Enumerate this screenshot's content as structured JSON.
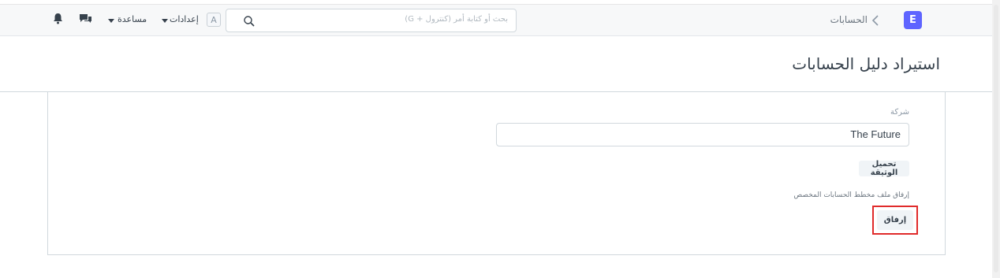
{
  "brand": {
    "letter": "E",
    "color": "#5e64ff"
  },
  "breadcrumb": {
    "label": "الحسابات"
  },
  "search": {
    "placeholder": "بحث أو كتابة أمر (كنترول + G)"
  },
  "user": {
    "avatar_letter": "A"
  },
  "nav": {
    "settings_label": "إعدادات",
    "help_label": "مساعدة"
  },
  "icons": {
    "search": "search-icon",
    "chat": "chat-icon",
    "bell": "bell-icon",
    "chevron": "chevron-icon",
    "caret": "caret-down-icon"
  },
  "page": {
    "title": "استيراد دليل الحسابات"
  },
  "form": {
    "company_label": "شركة",
    "company_value": "The Future",
    "download_template_label": "تحميل الوثيقة",
    "attach_label": "إرفاق ملف مخطط الحسابات المخصص",
    "attach_button_label": "إرفاق"
  },
  "colors": {
    "highlight": "#e02b2b",
    "navbar_bg": "#f7f8f9"
  }
}
